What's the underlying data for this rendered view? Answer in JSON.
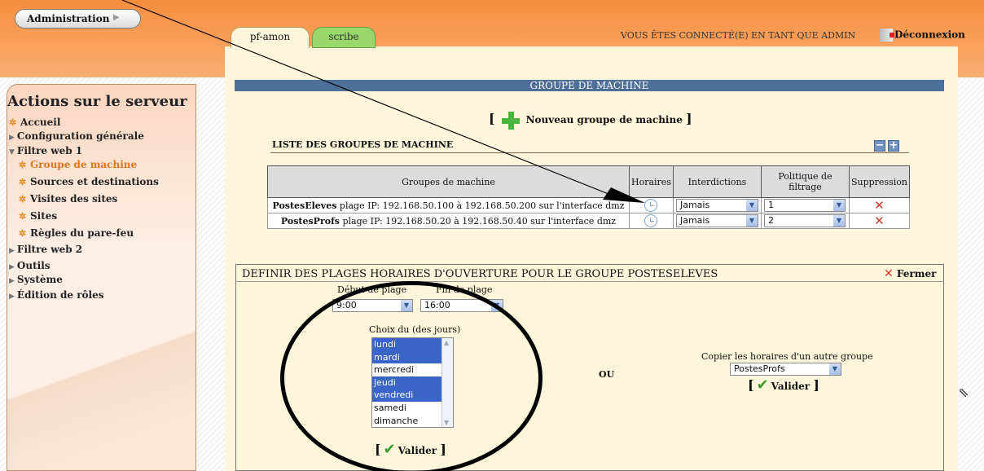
{
  "top_menu": {
    "admin_label": "Administration"
  },
  "tabs": [
    {
      "label": "pf-amon"
    },
    {
      "label": "scribe"
    }
  ],
  "header": {
    "login_text": "VOUS ÊTES CONNECTÉ(E) EN TANT QUE ADMIN",
    "logout_label": "Déconnexion"
  },
  "sidebar": {
    "title": "Actions sur le serveur",
    "items": [
      {
        "label": "Accueil",
        "kind": "leaf"
      },
      {
        "label": "Configuration générale",
        "kind": "collapsed"
      },
      {
        "label": "Filtre web 1",
        "kind": "expanded"
      },
      {
        "label": "Groupe de machine",
        "kind": "child",
        "selected": true
      },
      {
        "label": "Sources et destinations",
        "kind": "child"
      },
      {
        "label": "Visites des sites",
        "kind": "child"
      },
      {
        "label": "Sites",
        "kind": "child"
      },
      {
        "label": "Règles du pare-feu",
        "kind": "child"
      },
      {
        "label": "Filtre web 2",
        "kind": "collapsed"
      },
      {
        "label": "Outils",
        "kind": "collapsed"
      },
      {
        "label": "Système",
        "kind": "collapsed"
      },
      {
        "label": "Édition de rôles",
        "kind": "collapsed"
      }
    ]
  },
  "main": {
    "section_title": "GROUPE DE MACHINE",
    "new_group_label": "Nouveau groupe de machine",
    "list_title": "LISTE DES GROUPES DE MACHINE",
    "table": {
      "headers": [
        "Groupes de machine",
        "Horaires",
        "Interdictions",
        "Politique de filtrage",
        "Suppression"
      ],
      "rows": [
        {
          "name": "PostesEleves",
          "desc": "plage IP: 192.168.50.100 à 192.168.50.200 sur l'interface dmz",
          "interdiction": "Jamais",
          "politique": "1"
        },
        {
          "name": "PostesProfs",
          "desc": "plage IP: 192.168.50.20 à 192.168.50.40 sur l'interface dmz",
          "interdiction": "Jamais",
          "politique": "2"
        }
      ]
    }
  },
  "schedule_panel": {
    "title": "DEFINIR DES PLAGES HORAIRES D'OUVERTURE POUR LE GROUPE POSTESELEVES",
    "close_label": "Fermer",
    "start_label": "Début de plage",
    "end_label": "Fin de plage",
    "start_value": "9:00",
    "end_value": "16:00",
    "days_label": "Choix du (des jours)",
    "days": [
      {
        "label": "lundi",
        "selected": true
      },
      {
        "label": "mardi",
        "selected": true
      },
      {
        "label": "mercredi",
        "selected": false
      },
      {
        "label": "jeudi",
        "selected": true
      },
      {
        "label": "vendredi",
        "selected": true
      },
      {
        "label": "samedi",
        "selected": false
      },
      {
        "label": "dimanche",
        "selected": false
      }
    ],
    "validate_label": "Valider",
    "or_label": "OU",
    "copy_label": "Copier les horaires d'un autre groupe",
    "copy_value": "PostesProfs",
    "copy_validate_label": "Valider"
  },
  "colors": {
    "accent_orange": "#f68e3e",
    "header_blue": "#4e6f9a",
    "selected_blue": "#3b64c7",
    "panel_bg": "#fdf6da"
  }
}
